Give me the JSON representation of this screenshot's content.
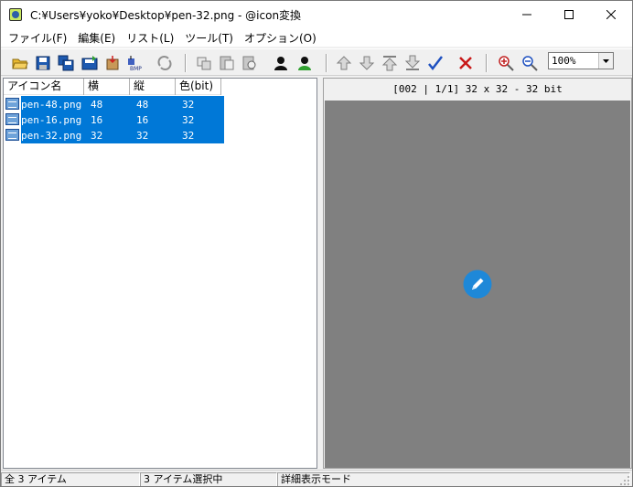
{
  "window": {
    "title": "C:¥Users¥yoko¥Desktop¥pen-32.png - @icon変換"
  },
  "menu": [
    {
      "label": "ファイル(F)"
    },
    {
      "label": "編集(E)"
    },
    {
      "label": "リスト(L)"
    },
    {
      "label": "ツール(T)"
    },
    {
      "label": "オプション(O)"
    }
  ],
  "toolbar": {
    "zoom_value": "100%",
    "icons": [
      "open-folder-icon",
      "save-icon",
      "save-all-icon",
      "save-as-icon",
      "extract-icon",
      "export-bmp-icon",
      "refresh-icon",
      "copy-icon",
      "paste-icon",
      "paste-replace-icon",
      "user-black-icon",
      "user-green-icon",
      "move-up-icon",
      "move-down-icon",
      "move-top-icon",
      "move-bottom-icon",
      "checkmark-icon",
      "delete-icon",
      "zoom-in-icon",
      "zoom-out-icon"
    ]
  },
  "list": {
    "columns": [
      "アイコン名",
      "横",
      "縦",
      "色(bit)"
    ],
    "rows": [
      {
        "name": "pen-48.png",
        "w": "48",
        "h": "48",
        "bits": "32"
      },
      {
        "name": "pen-16.png",
        "w": "16",
        "h": "16",
        "bits": "32"
      },
      {
        "name": "pen-32.png",
        "w": "32",
        "h": "32",
        "bits": "32"
      }
    ]
  },
  "preview": {
    "info": "[002 | 1/1] 32 x 32 - 32 bit",
    "accent_color": "#1e88d8"
  },
  "status": {
    "total": "全 3 アイテム",
    "selected": "3 アイテム選択中",
    "mode": "詳細表示モード"
  }
}
